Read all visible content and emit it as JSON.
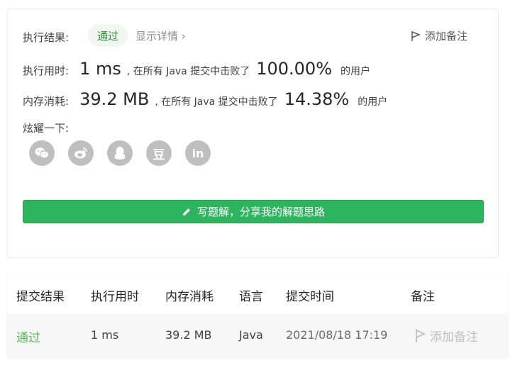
{
  "result": {
    "label": "执行结果:",
    "status": "通过",
    "detail_link": "显示详情",
    "detail_chevron": "›",
    "add_note": "添加备注"
  },
  "runtime": {
    "label": "执行用时:",
    "value": "1 ms",
    "mid_text": ", 在所有 Java 提交中击败了",
    "percent": "100.00%",
    "tail": "的用户"
  },
  "memory": {
    "label": "内存消耗:",
    "value": "39.2 MB",
    "mid_text": ", 在所有 Java 提交中击败了",
    "percent": "14.38%",
    "tail": "的用户"
  },
  "share": {
    "label": "炫耀一下:",
    "icons": [
      "wechat-icon",
      "weibo-icon",
      "qq-icon",
      "douban-icon",
      "linkedin-icon"
    ],
    "douban_glyph": "豆",
    "linkedin_glyph": "in",
    "button_label": "写题解，分享我的解题思路"
  },
  "table": {
    "headers": [
      "提交结果",
      "执行用时",
      "内存消耗",
      "语言",
      "提交时间",
      "备注"
    ],
    "rows": [
      {
        "status": "通过",
        "runtime": "1 ms",
        "memory": "39.2 MB",
        "language": "Java",
        "time": "2021/08/18 17:19",
        "note": "添加备注"
      }
    ]
  },
  "colors": {
    "accent_green": "#2db55d",
    "pass_text": "#2d8a3a",
    "pass_text_table": "#5cb85c",
    "icon_gray": "#bfbfbf"
  }
}
